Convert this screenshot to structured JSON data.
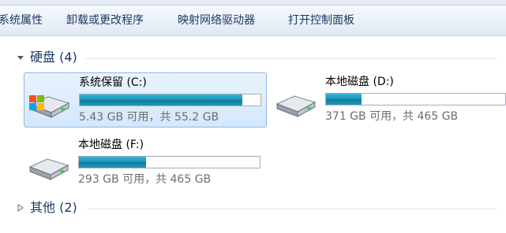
{
  "toolbar": {
    "items": [
      {
        "label": "系统属性"
      },
      {
        "label": "卸载或更改程序"
      },
      {
        "label": "映射网络驱动器"
      },
      {
        "label": "打开控制面板"
      }
    ]
  },
  "groups": {
    "hard_disks": {
      "label": "硬盘 (4)",
      "expanded": true
    },
    "other": {
      "label": "其他 (2)",
      "expanded": false
    }
  },
  "drives": [
    {
      "name": "系统保留 (C:)",
      "space": "5.43 GB 可用，共 55.2 GB",
      "used_fraction": 0.9,
      "selected": true,
      "icon": "windows-drive-icon"
    },
    {
      "name": "本地磁盘 (D:)",
      "space": "371 GB 可用，共 465 GB",
      "used_fraction": 0.2,
      "selected": false,
      "icon": "hard-drive-icon"
    },
    {
      "name": "本地磁盘 (F:)",
      "space": "293 GB 可用，共 465 GB",
      "used_fraction": 0.37,
      "selected": false,
      "icon": "hard-drive-icon"
    }
  ],
  "colors": {
    "bar_fill": "#1e97bb",
    "selection_bg": "#d4e7fc",
    "header_text": "#1e3964"
  }
}
